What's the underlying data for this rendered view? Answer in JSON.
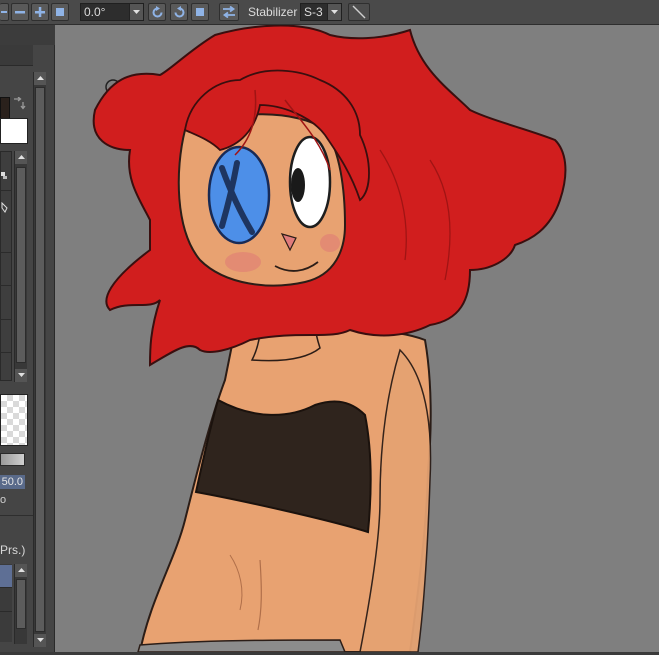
{
  "toolbar": {
    "angle_value": "0.0°",
    "stabilizer_label": "Stabilizer",
    "stabilizer_value": "S-3",
    "icons": [
      "zoom-out-icon",
      "zoom-in-icon",
      "fit-icon",
      "rotate-ccw-icon",
      "rotate-cw-icon",
      "reset-rotation-icon",
      "flip-horizontal-icon",
      "straight-line-icon"
    ]
  },
  "left_panel": {
    "brush_size_value": "50.0",
    "percent_fragment": "o",
    "pressure_label": "Prs.)"
  },
  "colors": {
    "foreground": "#2a211c",
    "background": "#ffffff",
    "accent": "#5e6f95",
    "canvas_bg": "#7f7f7f"
  }
}
